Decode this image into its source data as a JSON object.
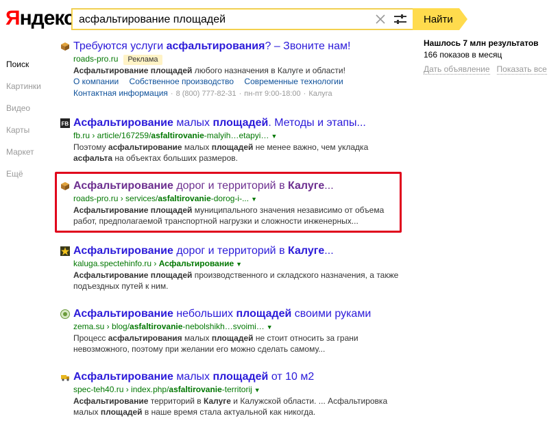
{
  "logo": {
    "first": "Я",
    "rest": "ндекс"
  },
  "search": {
    "value": "асфальтирование площадей",
    "button_label": "Найти"
  },
  "nav": [
    {
      "label": "Поиск",
      "active": true
    },
    {
      "label": "Картинки"
    },
    {
      "label": "Видео"
    },
    {
      "label": "Карты"
    },
    {
      "label": "Маркет"
    },
    {
      "label": "Ещё"
    }
  ],
  "sidebar": {
    "found": "Нашлось 7 млн результатов",
    "shows": "166 показов в месяц",
    "link_ad": "Дать объявление",
    "link_all": "Показать все"
  },
  "results": [
    {
      "favicon": "box-icon",
      "title_html": "Требуются услуги <b>асфальтирования</b>? – Звоните нам!",
      "url_html": "roads-pro.ru",
      "badge": "Реклама",
      "text_html": "<b>Асфальтирование площадей</b> любого назначения в Калуге и области!",
      "sitelinks": [
        "О компании",
        "Собственное производство",
        "Современные технологии"
      ],
      "contacts": {
        "link": "Контактная информация",
        "phone": "8 (800) 777-82-31",
        "hours": "пн-пт 9:00-18:00",
        "city": "Калуга"
      }
    },
    {
      "favicon": "fb-icon",
      "title_html": "<b>Асфальтирование</b> малых <b>площадей</b>. Методы и этапы...",
      "url_html": "fb.ru › article/167259/<b>asfaltirovanie</b>-malyih…etapyi…",
      "text_html": "Поэтому <b>асфальтирование</b> малых <b>площадей</b> не менее важно, чем укладка <b>асфальта</b> на объектах больших размеров."
    },
    {
      "favicon": "box-icon",
      "visited": true,
      "title_html": "<b>Асфальтирование</b> дорог и территорий в <b>Калуге</b>...",
      "url_html": "roads-pro.ru › services/<b>asfaltirovanie</b>-dorog-i-...",
      "text_html": "<b>Асфальтирование площадей</b> муниципального значения независимо от объема работ, предполагаемой транспортной нагрузки и сложности инженерных..."
    },
    {
      "favicon": "star-icon",
      "title_html": "<b>Асфальтирование</b> дорог и территорий в <b>Калуге</b>...",
      "url_html": "kaluga.spectehinfo.ru › <b>Асфальтирование</b>",
      "text_html": "<b>Асфальтирование площадей</b> производственного и складского назначения, а также подъездных путей к ним."
    },
    {
      "favicon": "zema-icon",
      "title_html": "<b>Асфальтирование</b> небольших <b>площадей</b> своими руками",
      "url_html": "zema.su › blog/<b>asfaltirovanie</b>-nebolshikh…svoimi…",
      "text_html": "Процесс <b>асфальтирования</b> малых <b>площадей</b> не стоит относить за грани невозможного, поэтому при желании его можно сделать самому..."
    },
    {
      "favicon": "truck-icon",
      "title_html": "<b>Асфальтирование</b> малых <b>площадей</b> от 10 м2",
      "url_html": "spec-teh40.ru › index.php/<b>asfaltirovanie</b>-territorij",
      "text_html": "<b>Асфальтирование</b> территорий в <b>Калуге</b> и Калужской области. ... Асфальтировка малых <b>площадей</b> в наше время стала актуальной как никогда."
    }
  ]
}
